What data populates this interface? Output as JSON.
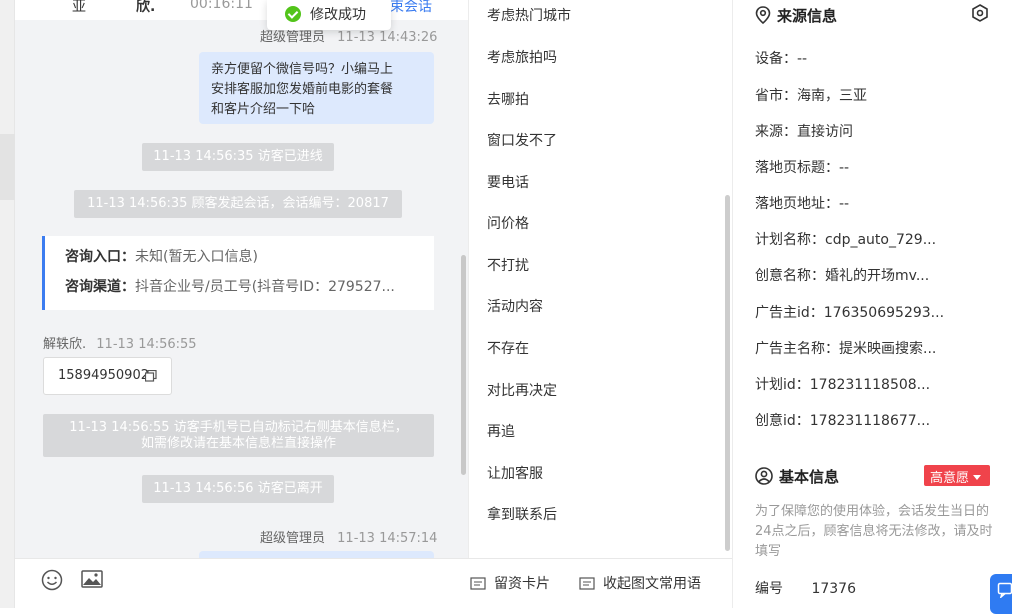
{
  "header": {
    "frag_left1": "亚",
    "frag_left2": "欣.",
    "timer": "00:16:11",
    "frag_right": "束会话"
  },
  "toast": {
    "text": "修改成功"
  },
  "chat": {
    "msg1_meta_name": "超级管理员",
    "msg1_meta_time": "11-13 14:43:26",
    "msg1_lines": [
      "亲方便留个微信号吗？小编马上",
      "安排客服加您发婚前电影的套餐",
      "和客片介绍一下哈"
    ],
    "sys1": "11-13 14:56:35 访客已进线",
    "sys2": "11-13 14:56:35 顾客发起会话，会话编号：20817",
    "info_entry_label": "咨询入口：",
    "info_entry_value": "未知(暂无入口信息)",
    "info_channel_label": "咨询渠道：",
    "info_channel_value": "抖音企业号/员工号(抖音号ID：279527...",
    "visitor_name": "解轶欣.",
    "visitor_time": "11-13 14:56:55",
    "phone": "15894950902",
    "sys3_line1": "11-13 14:56:55 访客手机号已自动标记右侧基本信息栏，",
    "sys3_line2": "如需修改请在基本信息栏直接操作",
    "sys4": "11-13 14:56:56 访客已离开",
    "msg2_meta_name": "超级管理员",
    "msg2_meta_time": "11-13 14:57:14"
  },
  "inputbar": {
    "card_label": "留资卡片",
    "phrases_label": "收起图文常用语"
  },
  "phrases": [
    "考虑热门城市",
    "考虑旅拍吗",
    "去哪拍",
    "窗口发不了",
    "要电话",
    "问价格",
    "不打扰",
    "活动内容",
    "不存在",
    "对比再决定",
    "再追",
    "让加客服",
    "拿到联系后"
  ],
  "source": {
    "title": "来源信息",
    "fields": [
      "设备：--",
      "省市：海南，三亚",
      "来源：直接访问",
      "落地页标题：--",
      "落地页地址：--",
      "计划名称：cdp_auto_729...",
      "创意名称：婚礼的开场mv...",
      "广告主id：176350695293...",
      "广告主名称：提米映画搜索...",
      "计划id：178231118508...",
      "创意id：178231118677..."
    ]
  },
  "basic": {
    "title": "基本信息",
    "badge": "高意愿",
    "note": "为了保障您的使用体验，会话发生当日的24点之后，顾客信息将无法修改，请及时填写",
    "id_label": "编号",
    "id_value": "17376"
  },
  "colors": {
    "accent": "#3b7cf0",
    "bubble": "#dde9fd",
    "badge": "#f0434b",
    "success": "#52c41a"
  }
}
